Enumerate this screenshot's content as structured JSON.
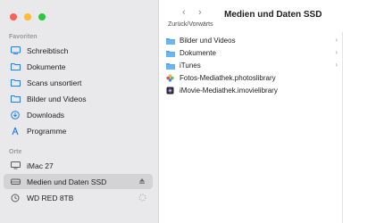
{
  "window": {
    "title": "Medien und Daten SSD",
    "nav_tooltip": "Zurück/Vorwärts",
    "back_glyph": "‹",
    "forward_glyph": "›"
  },
  "sidebar": {
    "favorites_title": "Favoriten",
    "favorites": [
      {
        "label": "Schreibtisch",
        "icon": "desktop-icon"
      },
      {
        "label": "Dokumente",
        "icon": "documents-folder-icon"
      },
      {
        "label": "Scans unsortiert",
        "icon": "folder-icon"
      },
      {
        "label": "Bilder und Videos",
        "icon": "folder-icon"
      },
      {
        "label": "Downloads",
        "icon": "downloads-icon"
      },
      {
        "label": "Programme",
        "icon": "applications-icon"
      }
    ],
    "locations_title": "Orte",
    "locations": [
      {
        "label": "iMac 27",
        "icon": "computer-icon"
      },
      {
        "label": "Medien und Daten SSD",
        "icon": "drive-icon",
        "selected": true,
        "trailing": "eject-icon"
      },
      {
        "label": "WD RED 8TB",
        "icon": "time-machine-icon",
        "trailing": "sync-icon"
      }
    ]
  },
  "file_list": {
    "items": [
      {
        "name": "Bilder und Videos",
        "icon": "folder-icon",
        "has_children": true
      },
      {
        "name": "Dokumente",
        "icon": "folder-icon",
        "has_children": true
      },
      {
        "name": "iTunes",
        "icon": "folder-icon",
        "has_children": true
      },
      {
        "name": "Fotos-Mediathek.photoslibrary",
        "icon": "photos-library-icon",
        "has_children": false
      },
      {
        "name": "iMovie-Mediathek.imovielibrary",
        "icon": "imovie-library-icon",
        "has_children": false
      }
    ],
    "chevron_glyph": "›"
  },
  "colors": {
    "sidebar_bg": "#e9e8ea",
    "selected_bg": "#d3d2d5",
    "accent_blue": "#1c7ef0",
    "folder_blue": "#4ea3e6"
  }
}
